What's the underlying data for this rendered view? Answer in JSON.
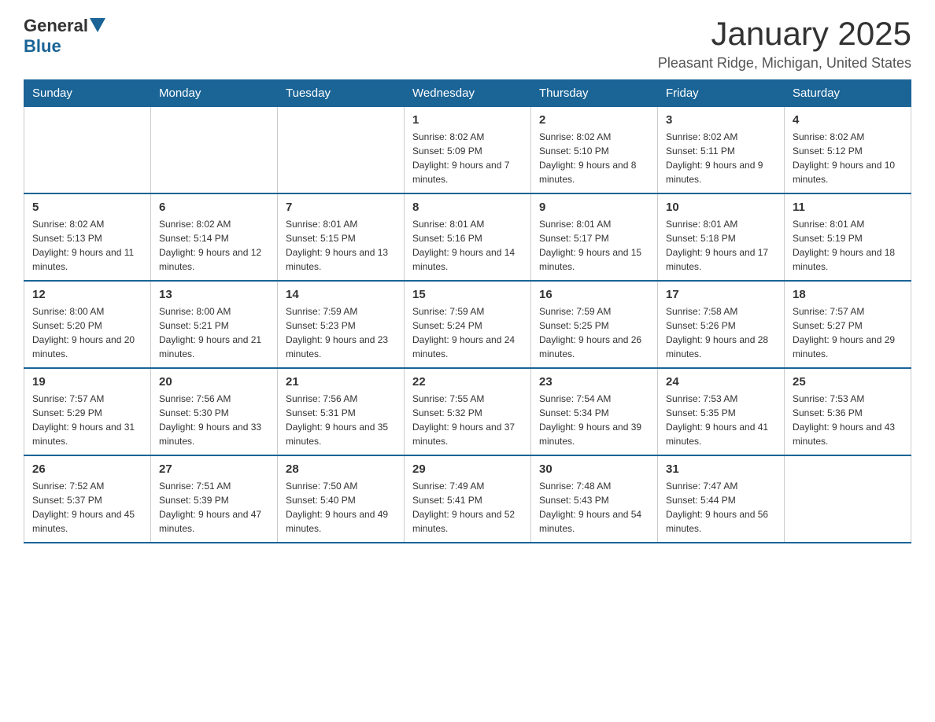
{
  "logo": {
    "general": "General",
    "blue": "Blue"
  },
  "header": {
    "month": "January 2025",
    "location": "Pleasant Ridge, Michigan, United States"
  },
  "days_of_week": [
    "Sunday",
    "Monday",
    "Tuesday",
    "Wednesday",
    "Thursday",
    "Friday",
    "Saturday"
  ],
  "weeks": [
    [
      {
        "num": "",
        "info": ""
      },
      {
        "num": "",
        "info": ""
      },
      {
        "num": "",
        "info": ""
      },
      {
        "num": "1",
        "info": "Sunrise: 8:02 AM\nSunset: 5:09 PM\nDaylight: 9 hours and 7 minutes."
      },
      {
        "num": "2",
        "info": "Sunrise: 8:02 AM\nSunset: 5:10 PM\nDaylight: 9 hours and 8 minutes."
      },
      {
        "num": "3",
        "info": "Sunrise: 8:02 AM\nSunset: 5:11 PM\nDaylight: 9 hours and 9 minutes."
      },
      {
        "num": "4",
        "info": "Sunrise: 8:02 AM\nSunset: 5:12 PM\nDaylight: 9 hours and 10 minutes."
      }
    ],
    [
      {
        "num": "5",
        "info": "Sunrise: 8:02 AM\nSunset: 5:13 PM\nDaylight: 9 hours and 11 minutes."
      },
      {
        "num": "6",
        "info": "Sunrise: 8:02 AM\nSunset: 5:14 PM\nDaylight: 9 hours and 12 minutes."
      },
      {
        "num": "7",
        "info": "Sunrise: 8:01 AM\nSunset: 5:15 PM\nDaylight: 9 hours and 13 minutes."
      },
      {
        "num": "8",
        "info": "Sunrise: 8:01 AM\nSunset: 5:16 PM\nDaylight: 9 hours and 14 minutes."
      },
      {
        "num": "9",
        "info": "Sunrise: 8:01 AM\nSunset: 5:17 PM\nDaylight: 9 hours and 15 minutes."
      },
      {
        "num": "10",
        "info": "Sunrise: 8:01 AM\nSunset: 5:18 PM\nDaylight: 9 hours and 17 minutes."
      },
      {
        "num": "11",
        "info": "Sunrise: 8:01 AM\nSunset: 5:19 PM\nDaylight: 9 hours and 18 minutes."
      }
    ],
    [
      {
        "num": "12",
        "info": "Sunrise: 8:00 AM\nSunset: 5:20 PM\nDaylight: 9 hours and 20 minutes."
      },
      {
        "num": "13",
        "info": "Sunrise: 8:00 AM\nSunset: 5:21 PM\nDaylight: 9 hours and 21 minutes."
      },
      {
        "num": "14",
        "info": "Sunrise: 7:59 AM\nSunset: 5:23 PM\nDaylight: 9 hours and 23 minutes."
      },
      {
        "num": "15",
        "info": "Sunrise: 7:59 AM\nSunset: 5:24 PM\nDaylight: 9 hours and 24 minutes."
      },
      {
        "num": "16",
        "info": "Sunrise: 7:59 AM\nSunset: 5:25 PM\nDaylight: 9 hours and 26 minutes."
      },
      {
        "num": "17",
        "info": "Sunrise: 7:58 AM\nSunset: 5:26 PM\nDaylight: 9 hours and 28 minutes."
      },
      {
        "num": "18",
        "info": "Sunrise: 7:57 AM\nSunset: 5:27 PM\nDaylight: 9 hours and 29 minutes."
      }
    ],
    [
      {
        "num": "19",
        "info": "Sunrise: 7:57 AM\nSunset: 5:29 PM\nDaylight: 9 hours and 31 minutes."
      },
      {
        "num": "20",
        "info": "Sunrise: 7:56 AM\nSunset: 5:30 PM\nDaylight: 9 hours and 33 minutes."
      },
      {
        "num": "21",
        "info": "Sunrise: 7:56 AM\nSunset: 5:31 PM\nDaylight: 9 hours and 35 minutes."
      },
      {
        "num": "22",
        "info": "Sunrise: 7:55 AM\nSunset: 5:32 PM\nDaylight: 9 hours and 37 minutes."
      },
      {
        "num": "23",
        "info": "Sunrise: 7:54 AM\nSunset: 5:34 PM\nDaylight: 9 hours and 39 minutes."
      },
      {
        "num": "24",
        "info": "Sunrise: 7:53 AM\nSunset: 5:35 PM\nDaylight: 9 hours and 41 minutes."
      },
      {
        "num": "25",
        "info": "Sunrise: 7:53 AM\nSunset: 5:36 PM\nDaylight: 9 hours and 43 minutes."
      }
    ],
    [
      {
        "num": "26",
        "info": "Sunrise: 7:52 AM\nSunset: 5:37 PM\nDaylight: 9 hours and 45 minutes."
      },
      {
        "num": "27",
        "info": "Sunrise: 7:51 AM\nSunset: 5:39 PM\nDaylight: 9 hours and 47 minutes."
      },
      {
        "num": "28",
        "info": "Sunrise: 7:50 AM\nSunset: 5:40 PM\nDaylight: 9 hours and 49 minutes."
      },
      {
        "num": "29",
        "info": "Sunrise: 7:49 AM\nSunset: 5:41 PM\nDaylight: 9 hours and 52 minutes."
      },
      {
        "num": "30",
        "info": "Sunrise: 7:48 AM\nSunset: 5:43 PM\nDaylight: 9 hours and 54 minutes."
      },
      {
        "num": "31",
        "info": "Sunrise: 7:47 AM\nSunset: 5:44 PM\nDaylight: 9 hours and 56 minutes."
      },
      {
        "num": "",
        "info": ""
      }
    ]
  ]
}
